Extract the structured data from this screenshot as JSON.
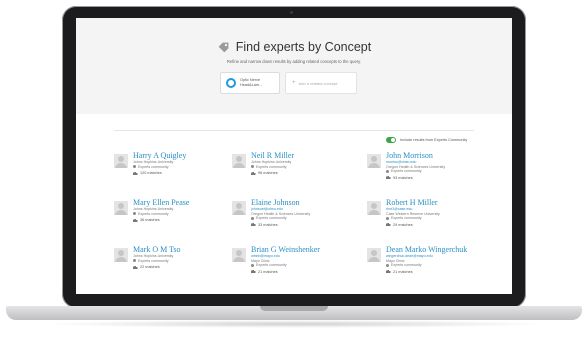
{
  "header": {
    "title": "Find experts by Concept",
    "subtitle": "Refine and narrow down results by adding related concepts to the query."
  },
  "concepts": {
    "chip_label": "Optic Nerve\nHead&Lam...",
    "add_label": "Add a related concept"
  },
  "filter": {
    "community_toggle_label": "Include results from Experts Community",
    "community_toggle_on": true
  },
  "experts": [
    {
      "name": "Harry A Quigley",
      "email": "",
      "affiliation": "Johns Hopkins University",
      "community": "Experts community",
      "matches": "120 matches"
    },
    {
      "name": "Neil R Miller",
      "email": "",
      "affiliation": "Johns Hopkins University",
      "community": "Experts community",
      "matches": "96 matches"
    },
    {
      "name": "John Morrison",
      "email": "morriso@ohsu.edu",
      "affiliation": "Oregon Health & Sciences University",
      "community": "Experts community",
      "matches": "93 matches"
    },
    {
      "name": "Mary Ellen Pease",
      "email": "",
      "affiliation": "Johns Hopkins University",
      "community": "Experts community",
      "matches": "36 matches"
    },
    {
      "name": "Elaine Johnson",
      "email": "johnsoel@ohsu.edu",
      "affiliation": "Oregon Health & Sciences University",
      "community": "Experts community",
      "matches": "33 matches"
    },
    {
      "name": "Robert H Miller",
      "email": "rhm3@case.edu",
      "affiliation": "Case Western Reserve University",
      "community": "Experts community",
      "matches": "29 matches"
    },
    {
      "name": "Mark O M Tso",
      "email": "",
      "affiliation": "Johns Hopkins University",
      "community": "Experts community",
      "matches": "22 matches"
    },
    {
      "name": "Brian G Weinshenker",
      "email": "weinb@mayo.edu",
      "affiliation": "Mayo Clinic",
      "community": "Experts community",
      "matches": "21 matches"
    },
    {
      "name": "Dean Marko Wingerchuk",
      "email": "wingerchuk.dean@mayo.edu",
      "affiliation": "Mayo Clinic",
      "community": "Experts community",
      "matches": "21 matches"
    }
  ],
  "colors": {
    "link": "#2a8fc4",
    "chip_ring": "#1e9be0",
    "toggle_on": "#3aa64a"
  },
  "icons": {
    "title": "tag-icon",
    "add": "plus-icon",
    "community": "community-icon",
    "matches": "matches-icon"
  }
}
